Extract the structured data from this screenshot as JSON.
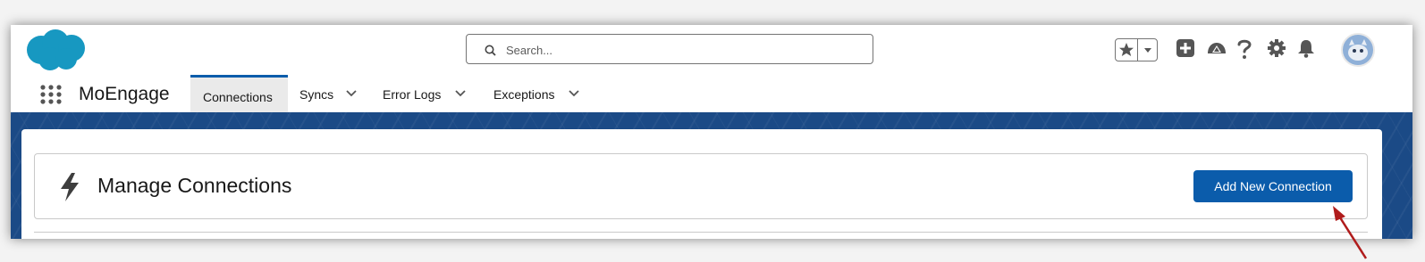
{
  "header": {
    "search": {
      "placeholder": "Search..."
    },
    "icons": [
      "salesforce-cloud-logo",
      "star-icon",
      "chevron-down-icon",
      "add-icon",
      "trailhead-icon",
      "help-icon",
      "setup-gear-icon",
      "bell-icon",
      "avatar"
    ]
  },
  "nav": {
    "app_name": "MoEngage",
    "tabs": [
      {
        "label": "Connections",
        "active": true
      },
      {
        "label": "Syncs",
        "dropdown": true
      },
      {
        "label": "Error Logs",
        "dropdown": true
      },
      {
        "label": "Exceptions",
        "dropdown": true
      }
    ]
  },
  "main": {
    "title": "Manage Connections",
    "add_button": "Add New Connection"
  },
  "colors": {
    "brand_blue": "#0b5cab",
    "cloud_blue": "#1798c1",
    "banner": "#1b4a86",
    "annotation_arrow": "#b01c1c"
  }
}
